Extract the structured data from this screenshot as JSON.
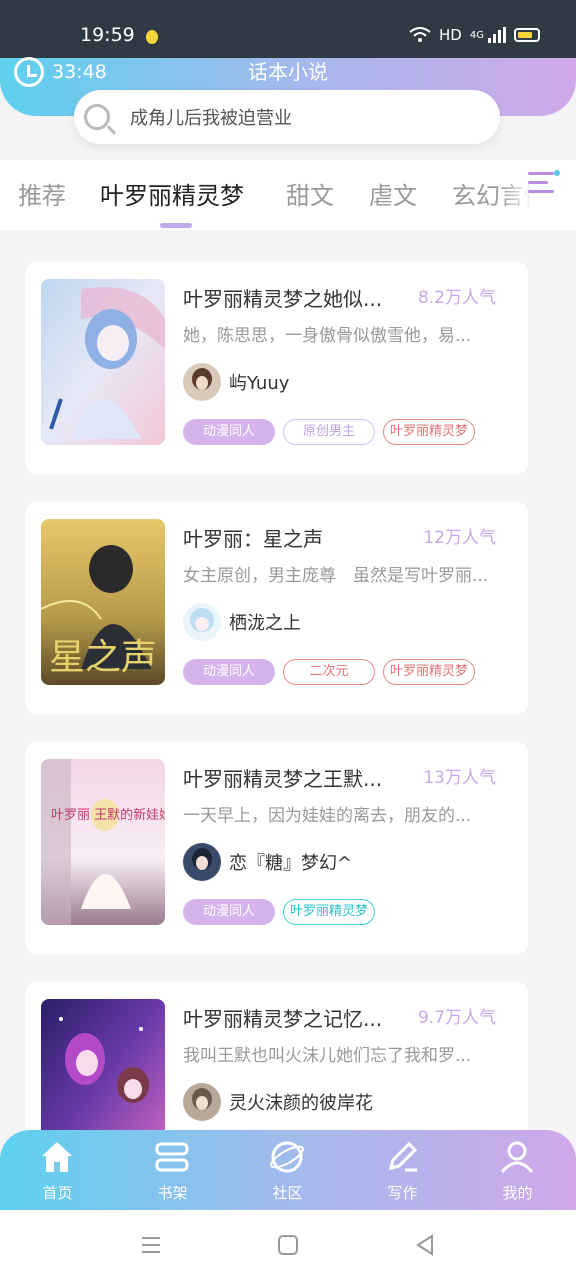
{
  "status_bar": {
    "time": "19:59",
    "network": "HD",
    "network_type": "4G"
  },
  "header": {
    "timer": "33:48",
    "app_title": "话本小说"
  },
  "search": {
    "placeholder": "成角儿后我被迫营业"
  },
  "tabs": [
    {
      "label": "推荐"
    },
    {
      "label": "叶罗丽精灵梦"
    },
    {
      "label": "甜文"
    },
    {
      "label": "虐文"
    },
    {
      "label": "玄幻言情"
    }
  ],
  "active_tab": "叶罗丽精灵梦",
  "books": [
    {
      "title": "叶罗丽精灵梦之她似...",
      "popularity": "8.2万人气",
      "description": "她，陈思思，一身傲骨似傲雪他，易...",
      "author": "屿Yuuy",
      "tags": [
        "动漫同人",
        "原创男主",
        "叶罗丽精灵梦"
      ]
    },
    {
      "title": "叶罗丽：星之声",
      "popularity": "12万人气",
      "description": "女主原创，男主庞尊　虽然是写叶罗丽...",
      "author": "栖泷之上",
      "tags": [
        "动漫同人",
        "二次元",
        "叶罗丽精灵梦"
      ],
      "cover_text": "星之声"
    },
    {
      "title": "叶罗丽精灵梦之王默...",
      "popularity": "13万人气",
      "description": "一天早上，因为娃娃的离去，朋友的...",
      "author": "恋『糖』梦幻^",
      "tags": [
        "动漫同人",
        "叶罗丽精灵梦"
      ],
      "cover_text": "叶罗丽 王默的新娃娃"
    },
    {
      "title": "叶罗丽精灵梦之记忆...",
      "popularity": "9.7万人气",
      "description": "我叫王默也叫火沫儿她们忘了我和罗...",
      "author": "灵火沫颜的彼岸花",
      "tags": []
    }
  ],
  "bottom_nav": [
    {
      "label": "首页",
      "icon": "home-icon"
    },
    {
      "label": "书架",
      "icon": "bookshelf-icon"
    },
    {
      "label": "社区",
      "icon": "community-icon"
    },
    {
      "label": "写作",
      "icon": "write-icon"
    },
    {
      "label": "我的",
      "icon": "profile-icon"
    }
  ],
  "colors": {
    "accent_gradient_start": "#5ed0ee",
    "accent_gradient_end": "#d0a8ea",
    "tag_fill": "#d3b4ec",
    "popularity": "#c8a8ea"
  }
}
